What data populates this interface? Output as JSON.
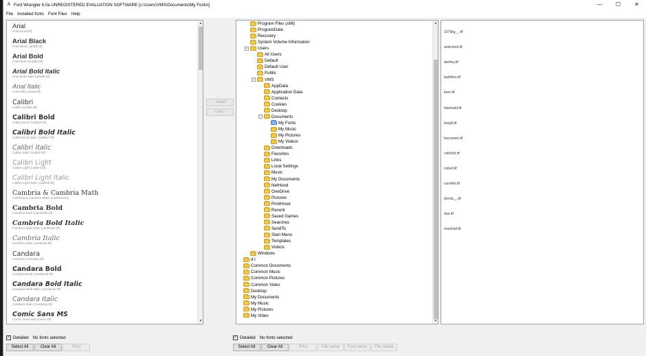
{
  "window": {
    "title": "Font Wrangler 6.0a  UNREGISTERED EVALUATION SOFTWARE  [c:\\Users\\VMS\\Documents\\My Fonts\\]",
    "minimize": "—",
    "maximize": "☐",
    "close": "✕"
  },
  "menu": [
    "File",
    "Installed fonts",
    "Font Files",
    "Help"
  ],
  "fonts": [
    {
      "name": "Arial",
      "file": "Arial (arial.ttf)",
      "family": "\"Liberation Sans\", sans-serif",
      "weight": "normal",
      "style": "normal"
    },
    {
      "name": "Arial Black",
      "file": "Arial Black (ariblk.ttf)",
      "family": "\"Liberation Sans\", sans-serif",
      "weight": "900",
      "style": "normal"
    },
    {
      "name": "Arial Bold",
      "file": "Arial Bold (arialbd.ttf)",
      "family": "\"Liberation Sans\", sans-serif",
      "weight": "bold",
      "style": "normal"
    },
    {
      "name": "Arial Bold Italic",
      "file": "Arial Bold Italic (arialbi.ttf)",
      "family": "\"Liberation Sans\", sans-serif",
      "weight": "bold",
      "style": "italic"
    },
    {
      "name": "Arial Italic",
      "file": "Arial Italic (ariali.ttf)",
      "family": "\"Liberation Sans\", sans-serif",
      "weight": "normal",
      "style": "italic"
    },
    {
      "name": "Calibri",
      "file": "Calibri (calibri.ttf)",
      "family": "\"DejaVu Sans\", sans-serif",
      "weight": "normal",
      "style": "normal"
    },
    {
      "name": "Calibri Bold",
      "file": "Calibri Bold (calibrib.ttf)",
      "family": "\"DejaVu Sans\", sans-serif",
      "weight": "bold",
      "style": "normal"
    },
    {
      "name": "Calibri Bold Italic",
      "file": "Calibri Bold Italic (calibriz.ttf)",
      "family": "\"DejaVu Sans\", sans-serif",
      "weight": "bold",
      "style": "italic"
    },
    {
      "name": "Calibri Italic",
      "file": "Calibri Italic (calibrii.ttf)",
      "family": "\"DejaVu Sans\", sans-serif",
      "weight": "normal",
      "style": "italic"
    },
    {
      "name": "Calibri Light",
      "file": "Calibri Light (calibril.ttf)",
      "family": "\"DejaVu Sans\", sans-serif",
      "weight": "300",
      "style": "normal"
    },
    {
      "name": "Calibri Light Italic",
      "file": "Calibri Light Italic (calibrili.ttf)",
      "family": "\"DejaVu Sans\", sans-serif",
      "weight": "300",
      "style": "italic"
    },
    {
      "name": "Cambria & Cambria Math",
      "file": "Cambria & Cambria Math (cambria.ttc)",
      "family": "\"DejaVu Serif\", serif",
      "weight": "normal",
      "style": "normal"
    },
    {
      "name": "Cambria Bold",
      "file": "Cambria Bold (cambriab.ttf)",
      "family": "\"DejaVu Serif\", serif",
      "weight": "bold",
      "style": "normal"
    },
    {
      "name": "Cambria Bold Italic",
      "file": "Cambria Bold Italic (cambriaz.ttf)",
      "family": "\"DejaVu Serif\", serif",
      "weight": "bold",
      "style": "italic"
    },
    {
      "name": "Cambria Italic",
      "file": "Cambria Italic (cambriai.ttf)",
      "family": "\"DejaVu Serif\", serif",
      "weight": "normal",
      "style": "italic"
    },
    {
      "name": "Candara",
      "file": "Candara (candara.ttf)",
      "family": "\"DejaVu Sans\", sans-serif",
      "weight": "normal",
      "style": "normal"
    },
    {
      "name": "Candara Bold",
      "file": "Candara Bold (candarab.ttf)",
      "family": "\"DejaVu Sans\", sans-serif",
      "weight": "bold",
      "style": "normal"
    },
    {
      "name": "Candara Bold Italic",
      "file": "Candara Bold Italic (candaraz.ttf)",
      "family": "\"DejaVu Sans\", sans-serif",
      "weight": "bold",
      "style": "italic"
    },
    {
      "name": "Candara Italic",
      "file": "Candara Italic (candarai.ttf)",
      "family": "\"DejaVu Sans\", sans-serif",
      "weight": "normal",
      "style": "italic"
    },
    {
      "name": "Comic Sans MS",
      "file": "Comic Sans MS (comic.ttf)",
      "family": "\"DejaVu Sans\", sans-serif",
      "weight": "bold",
      "style": "italic"
    }
  ],
  "middle_buttons": {
    "install": "‹ Install",
    "copy": "Copy ›"
  },
  "tree": [
    {
      "label": "Program Files (x86)",
      "depth": 1
    },
    {
      "label": "ProgramData",
      "depth": 1
    },
    {
      "label": "Recovery",
      "depth": 1
    },
    {
      "label": "System Volume Information",
      "depth": 1
    },
    {
      "label": "Users",
      "depth": 1,
      "expanded": true
    },
    {
      "label": "All Users",
      "depth": 2
    },
    {
      "label": "Default",
      "depth": 2
    },
    {
      "label": "Default User",
      "depth": 2
    },
    {
      "label": "Public",
      "depth": 2
    },
    {
      "label": "VMS",
      "depth": 2,
      "expanded": true
    },
    {
      "label": "AppData",
      "depth": 3
    },
    {
      "label": "Application Data",
      "depth": 3
    },
    {
      "label": "Contacts",
      "depth": 3
    },
    {
      "label": "Cookies",
      "depth": 3
    },
    {
      "label": "Desktop",
      "depth": 3
    },
    {
      "label": "Documents",
      "depth": 3,
      "expanded": true
    },
    {
      "label": "My Fonts",
      "depth": 4,
      "selected": true
    },
    {
      "label": "My Music",
      "depth": 4
    },
    {
      "label": "My Pictures",
      "depth": 4
    },
    {
      "label": "My Videos",
      "depth": 4
    },
    {
      "label": "Downloads",
      "depth": 3
    },
    {
      "label": "Favorites",
      "depth": 3
    },
    {
      "label": "Links",
      "depth": 3
    },
    {
      "label": "Local Settings",
      "depth": 3
    },
    {
      "label": "Music",
      "depth": 3
    },
    {
      "label": "My Documents",
      "depth": 3
    },
    {
      "label": "NetHood",
      "depth": 3
    },
    {
      "label": "OneDrive",
      "depth": 3
    },
    {
      "label": "Pictures",
      "depth": 3
    },
    {
      "label": "PrintHood",
      "depth": 3
    },
    {
      "label": "Recent",
      "depth": 3
    },
    {
      "label": "Saved Games",
      "depth": 3
    },
    {
      "label": "Searches",
      "depth": 3
    },
    {
      "label": "SendTo",
      "depth": 3
    },
    {
      "label": "Start Menu",
      "depth": 3
    },
    {
      "label": "Templates",
      "depth": 3
    },
    {
      "label": "Videos",
      "depth": 3
    },
    {
      "label": "Windows",
      "depth": 1
    },
    {
      "label": "d:\\",
      "depth": 0
    },
    {
      "label": "Common Documents",
      "depth": 0
    },
    {
      "label": "Common Music",
      "depth": 0
    },
    {
      "label": "Common Pictures",
      "depth": 0
    },
    {
      "label": "Common Video",
      "depth": 0
    },
    {
      "label": "Desktop",
      "depth": 0
    },
    {
      "label": "My Documents",
      "depth": 0
    },
    {
      "label": "My Music",
      "depth": 0
    },
    {
      "label": "My Pictures",
      "depth": 0
    },
    {
      "label": "My Video",
      "depth": 0
    }
  ],
  "files": [
    "1979kg__.ttf",
    "androired.ttf",
    "atchley.ttf",
    "badfilms.ttf",
    "bern.ttf",
    "blackadd.ttf",
    "borg9.ttf",
    "buccanee.ttf",
    "celticfrd.ttf",
    "coiled.ttf",
    "cuneifor.ttf",
    "dorcla__.ttf",
    "dua.ttf",
    "marshall.ttf"
  ],
  "left_footer": {
    "detailed": "Detailed",
    "status": "No fonts selected",
    "buttons": [
      "Select All",
      "Clear All",
      "Print"
    ]
  },
  "right_footer": {
    "detailed": "Detailed",
    "status": "No fonts selected",
    "buttons": [
      "Select All",
      "Clear All",
      "Print",
      "File name",
      "Font name",
      "File delete"
    ]
  }
}
